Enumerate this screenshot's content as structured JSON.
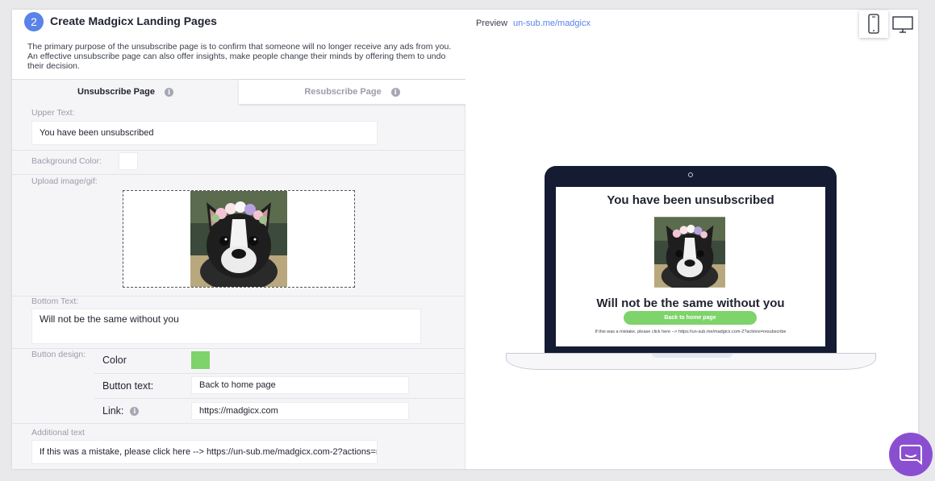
{
  "header": {
    "step_number": "2",
    "title": "Create Madgicx Landing Pages",
    "description": "The primary purpose of the unsubscribe page is to confirm that someone will no longer receive any ads from you. An effective unsubscribe page can also offer insights, make people change their minds by offering them to undo their decision."
  },
  "tabs": [
    {
      "label": "Unsubscribe Page",
      "active": true
    },
    {
      "label": "Resubscribe Page",
      "active": false
    }
  ],
  "form": {
    "upper_text_label": "Upper Text:",
    "upper_text_value": "You have been unsubscribed",
    "background_color_label": "Background Color:",
    "background_color_value": "#ffffff",
    "upload_label": "Upload image/gif:",
    "bottom_text_label": "Bottom Text:",
    "bottom_text_value": "Will not be the same without you",
    "button_design_label": "Button design:",
    "color_label": "Color",
    "button_color": "#7ed36b",
    "button_text_label": "Button text:",
    "button_text_value": "Back to home page",
    "link_label": "Link:",
    "link_value": "https://madgicx.com",
    "additional_text_label": "Additional text",
    "additional_text_value": "If this was a mistake, please click here --> https://un-sub.me/madgicx.com-2?actions=res"
  },
  "preview": {
    "label": "Preview",
    "link": "un-sub.me/madgicx",
    "devices": [
      {
        "icon": "mobile-icon",
        "active": true
      },
      {
        "icon": "desktop-icon",
        "active": false
      }
    ],
    "screen": {
      "upper_text": "You have been unsubscribed",
      "bottom_text": "Will not be the same without you",
      "button_text": "Back to home page",
      "additional_text": "If this was a mistake, please click here --> https://un-sub.me/madgicx.com-2?actions=resubscribe"
    }
  },
  "colors": {
    "accent": "#5a82e8",
    "button_green": "#7ed36b",
    "laptop_frame": "#141b33",
    "chat_purple": "#8a4fd1"
  },
  "chat_widget": {
    "icon": "chat-icon"
  }
}
